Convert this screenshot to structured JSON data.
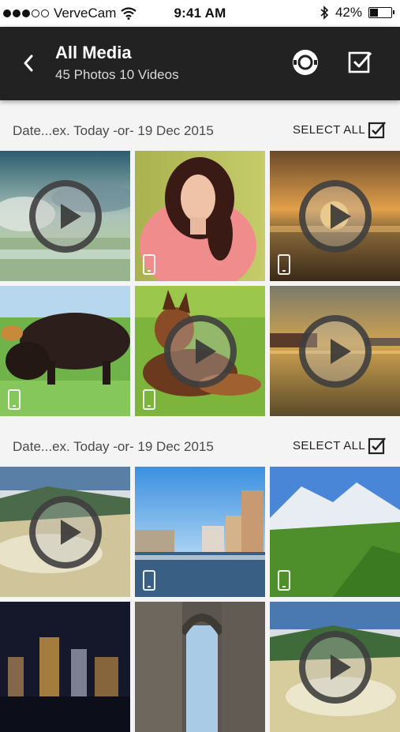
{
  "status_bar": {
    "carrier": "VerveCam",
    "time": "9:41 AM",
    "battery": "42%",
    "battery_level": 0.42,
    "signal_bars": 3,
    "signal_max": 5
  },
  "header": {
    "title": "All Media",
    "subtitle": "45 Photos 10 Videos",
    "back_icon": "chevron-left-icon",
    "camera_icon": "camera-lens-icon",
    "select_icon": "checkbox-icon"
  },
  "sections": [
    {
      "date_label": "Date...ex. Today -or- 19 Dec 2015",
      "select_all": "SELECT ALL",
      "items": [
        {
          "subject": "lake-sky",
          "video": true
        },
        {
          "subject": "portrait",
          "video": false
        },
        {
          "subject": "sunset-sea",
          "video": true
        },
        {
          "subject": "cattle",
          "video": false
        },
        {
          "subject": "dog",
          "video": true
        },
        {
          "subject": "harbour-sunset",
          "video": true
        }
      ]
    },
    {
      "date_label": "Date...ex. Today -or- 19 Dec 2015",
      "select_all": "SELECT ALL",
      "items": [
        {
          "subject": "terraces",
          "video": true
        },
        {
          "subject": "marina-city",
          "video": false
        },
        {
          "subject": "alpine-meadow",
          "video": false
        },
        {
          "subject": "night-city",
          "video": false
        },
        {
          "subject": "arch-street",
          "video": false
        },
        {
          "subject": "terraces-2",
          "video": true
        }
      ]
    }
  ],
  "colors": {
    "header_bg": "#222222",
    "page_bg": "#f4f4f4",
    "play_ring": "#373737"
  }
}
